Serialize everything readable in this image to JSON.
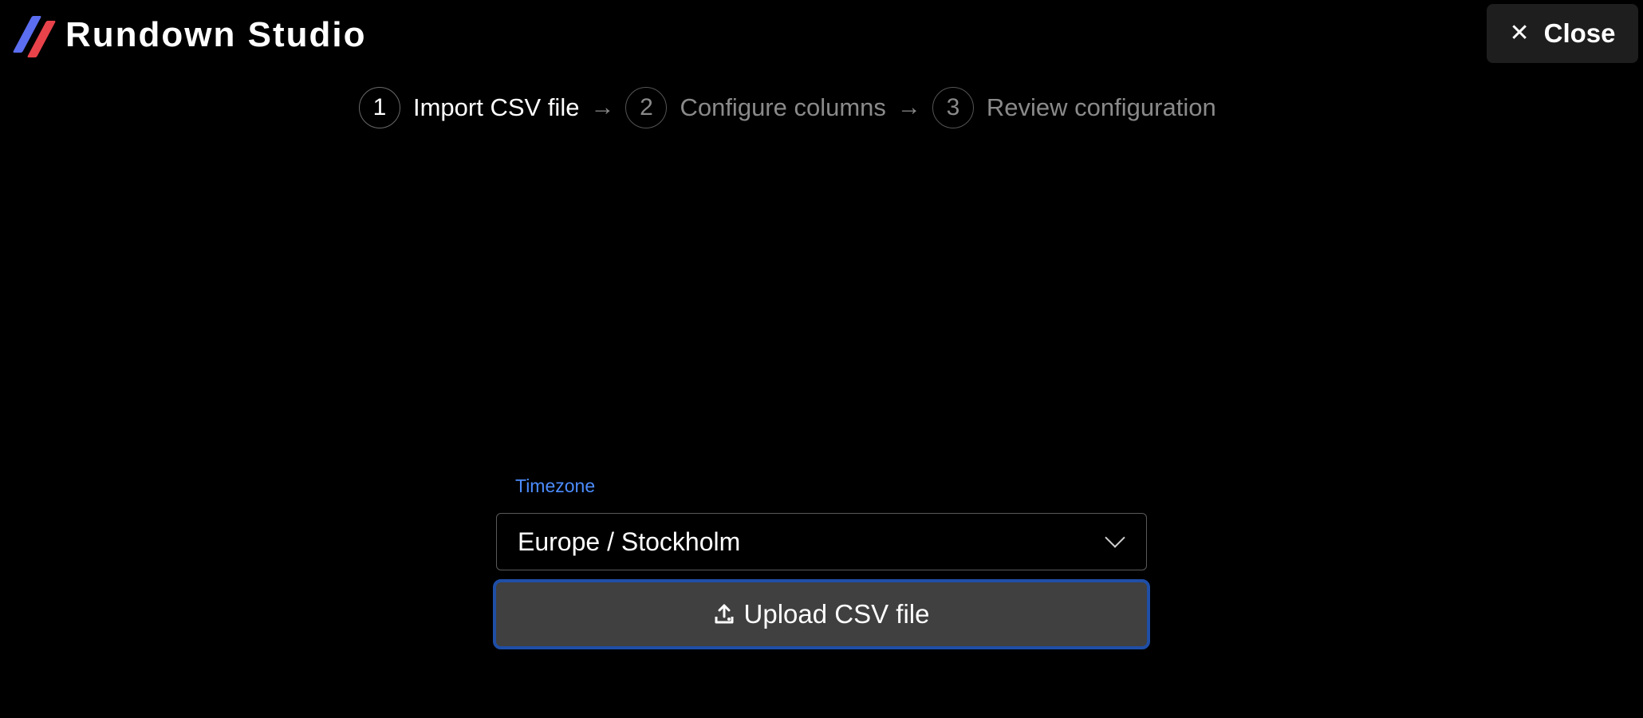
{
  "app": {
    "title": "Rundown Studio",
    "logo_colors": [
      "#5b6df0",
      "#e8424a"
    ]
  },
  "header": {
    "close_label": "Close",
    "close_icon": "close-icon"
  },
  "stepper": {
    "steps": [
      {
        "number": "1",
        "label": "Import CSV file",
        "state": "active"
      },
      {
        "number": "2",
        "label": "Configure columns",
        "state": "inactive"
      },
      {
        "number": "3",
        "label": "Review configuration",
        "state": "inactive"
      }
    ],
    "separator": "→"
  },
  "form": {
    "timezone_label": "Timezone",
    "timezone_value": "Europe / Stockholm",
    "upload_label": "Upload CSV file",
    "upload_icon": "upload-icon"
  },
  "colors": {
    "background": "#000000",
    "accent_label": "#4c8cff",
    "upload_border": "#1f4ea6",
    "upload_bg": "#404040"
  }
}
